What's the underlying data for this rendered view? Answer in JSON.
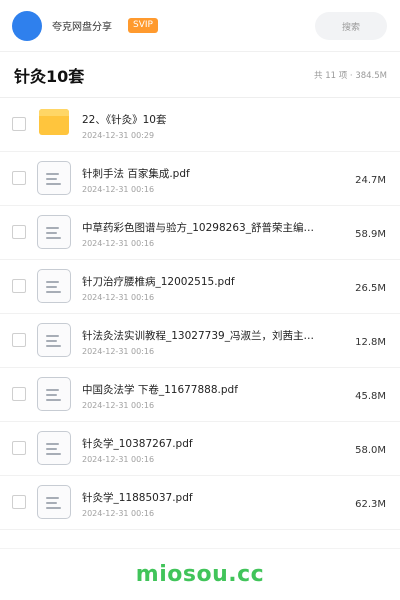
{
  "header": {
    "site_name": "夸克网盘分享",
    "badge": "SVIP",
    "search_placeholder": "搜索",
    "avatar_color": "#2f80ed",
    "badge_color": "#ff9a2e"
  },
  "folder": {
    "title": "针灸10套",
    "meta": "共 11 项 · 384.5M"
  },
  "files": [
    {
      "icon": "folder-icon",
      "name": "22、《针灸》10套",
      "date": "2024-12-31 00:29",
      "size": ""
    },
    {
      "icon": "document-icon",
      "name": "针刺手法 百家集成.pdf",
      "date": "2024-12-31 00:16",
      "size": "24.7M"
    },
    {
      "icon": "document-icon",
      "name": "中草药彩色图谱与验方_10298263_舒普荣主编…",
      "date": "2024-12-31 00:16",
      "size": "58.9M"
    },
    {
      "icon": "document-icon",
      "name": "针刀治疗腰椎病_12002515.pdf",
      "date": "2024-12-31 00:16",
      "size": "26.5M"
    },
    {
      "icon": "document-icon",
      "name": "针法灸法实训教程_13027739_冯淑兰，刘茜主…",
      "date": "2024-12-31 00:16",
      "size": "12.8M"
    },
    {
      "icon": "document-icon",
      "name": "中国灸法学 下卷_11677888.pdf",
      "date": "2024-12-31 00:16",
      "size": "45.8M"
    },
    {
      "icon": "document-icon",
      "name": "针灸学_10387267.pdf",
      "date": "2024-12-31 00:16",
      "size": "58.0M"
    },
    {
      "icon": "document-icon",
      "name": "针灸学_11885037.pdf",
      "date": "2024-12-31 00:16",
      "size": "62.3M"
    }
  ],
  "footer": {
    "brand": "miosou.cc",
    "brand_color": "#41c45a"
  }
}
